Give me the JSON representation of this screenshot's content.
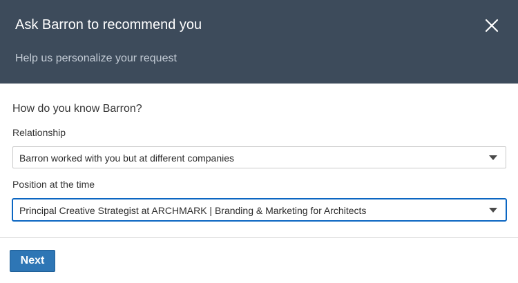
{
  "header": {
    "title": "Ask Barron to recommend you",
    "subtitle": "Help us personalize your request",
    "close_icon": "close-icon"
  },
  "form": {
    "question": "How do you know Barron?",
    "relationship": {
      "label": "Relationship",
      "value": "Barron worked with you but at different companies"
    },
    "position": {
      "label": "Position at the time",
      "value": "Principal Creative Strategist at ARCHMARK | Branding & Marketing for Architects"
    }
  },
  "footer": {
    "next_label": "Next"
  },
  "colors": {
    "header_bg": "#3d4b5b",
    "primary_button": "#2e76b5",
    "focus_border": "#0b66c2"
  }
}
